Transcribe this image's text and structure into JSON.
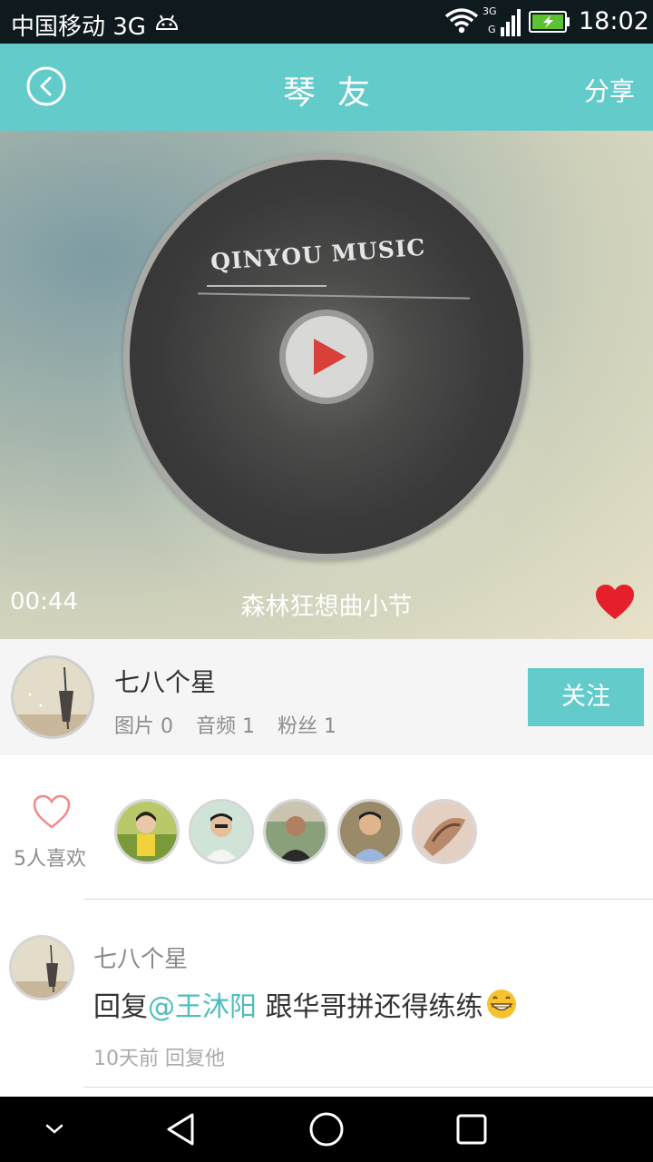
{
  "status_bar": {
    "carrier": "中国移动 3G",
    "network_label_top": "3G",
    "network_label_bottom": "G",
    "time": "18:02",
    "icons": [
      "android-icon",
      "wifi-icon",
      "signal-icon",
      "battery-charging-icon"
    ]
  },
  "header": {
    "title": "琴友",
    "share_label": "分享",
    "color": "#64cbcb"
  },
  "player": {
    "disc_brand": "QINYOU MUSIC",
    "elapsed": "00:44",
    "song_title": "森林狂想曲小节",
    "liked": true,
    "heart_color": "#e5202b",
    "play_color": "#d9403a"
  },
  "user": {
    "name": "七八个星",
    "stats": [
      "图片 0",
      "音频 1",
      "粉丝 1"
    ],
    "follow_label": "关注"
  },
  "likes": {
    "label": "5人喜欢",
    "count": 5
  },
  "comments": [
    {
      "user": "七八个星",
      "prefix": "回复",
      "mention": "@王沐阳",
      "text": " 跟华哥拼还得练练",
      "emoji": "grinning-emoji",
      "meta": "10天前 回复他"
    }
  ],
  "navbar": {
    "icons": [
      "collapse-icon",
      "back-icon",
      "home-icon",
      "recents-icon"
    ]
  }
}
